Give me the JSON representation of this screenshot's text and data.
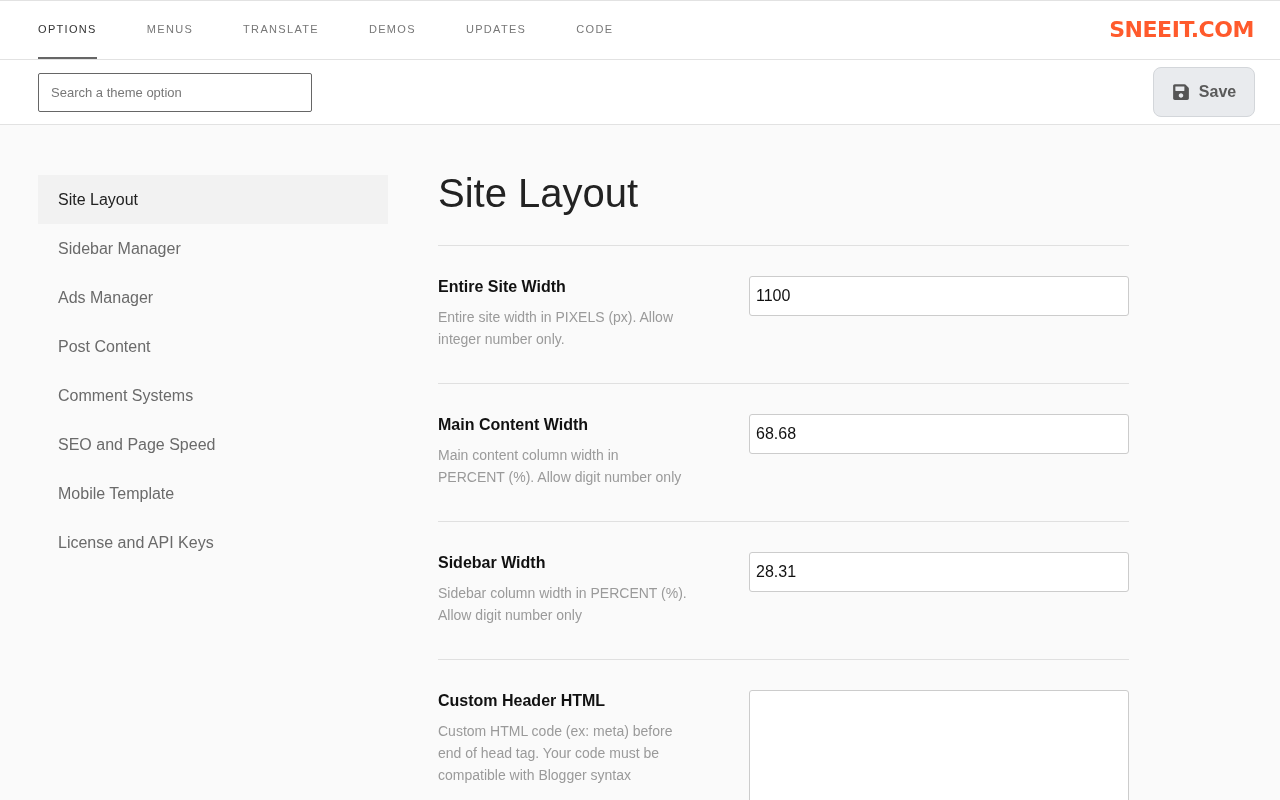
{
  "tabs": [
    {
      "label": "OPTIONS",
      "selected": true
    },
    {
      "label": "MENUS",
      "selected": false
    },
    {
      "label": "TRANSLATE",
      "selected": false
    },
    {
      "label": "DEMOS",
      "selected": false
    },
    {
      "label": "UPDATES",
      "selected": false
    },
    {
      "label": "CODE",
      "selected": false
    }
  ],
  "logo": {
    "text": "SNEEIT.COM"
  },
  "search": {
    "placeholder": "Search a theme option"
  },
  "save_button": {
    "label": "Save"
  },
  "sidebar": {
    "items": [
      {
        "label": "Site Layout",
        "selected": true
      },
      {
        "label": "Sidebar Manager",
        "selected": false
      },
      {
        "label": "Ads Manager",
        "selected": false
      },
      {
        "label": "Post Content",
        "selected": false
      },
      {
        "label": "Comment Systems",
        "selected": false
      },
      {
        "label": "SEO and Page Speed",
        "selected": false
      },
      {
        "label": "Mobile Template",
        "selected": false
      },
      {
        "label": "License and API Keys",
        "selected": false
      }
    ]
  },
  "section": {
    "title": "Site Layout",
    "fields": [
      {
        "kind": "input",
        "label": "Entire Site Width",
        "description": "Entire site width in PIXELS (px). Allow integer number only.",
        "value": "1100"
      },
      {
        "kind": "input",
        "label": "Main Content Width",
        "description": "Main content column width in PERCENT (%). Allow digit number only",
        "value": "68.68"
      },
      {
        "kind": "input",
        "label": "Sidebar Width",
        "description": "Sidebar column width in PERCENT (%). Allow digit number only",
        "value": "28.31"
      },
      {
        "kind": "textarea",
        "label": "Custom Header HTML",
        "description": "Custom HTML code (ex: meta) before end of head tag. Your code must be compatible with Blogger syntax"
      }
    ]
  }
}
